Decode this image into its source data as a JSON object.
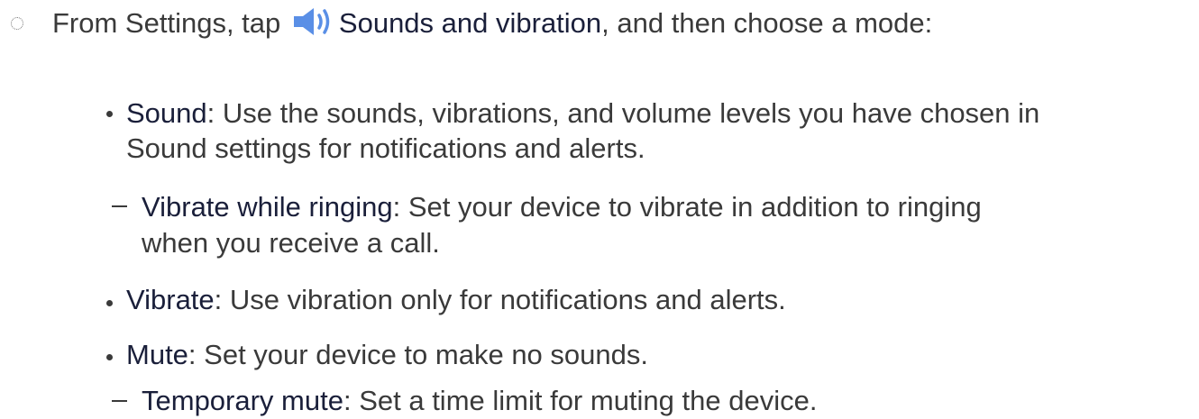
{
  "step": {
    "prefix": "From Settings, tap",
    "icon": "sound-speaker-icon",
    "icon_color": "#5a8fe6",
    "term": "Sounds and vibration",
    "suffix": ", and then choose a mode:"
  },
  "modes": [
    {
      "term": "Sound",
      "desc_line1": ": Use the sounds, vibrations, and volume levels you have chosen in",
      "desc_line2": "Sound settings for notifications and alerts.",
      "sub": {
        "term": "Vibrate while ringing",
        "desc_line1": ": Set your device to vibrate in addition to ringing",
        "desc_line2": "when you receive a call."
      }
    },
    {
      "term": "Vibrate",
      "desc_line1": ": Use vibration only for notifications and alerts."
    },
    {
      "term": "Mute",
      "desc_line1": ": Set your device to make no sounds.",
      "sub": {
        "term": "Temporary mute",
        "desc_line1": ": Set a time limit for muting the device."
      }
    }
  ]
}
